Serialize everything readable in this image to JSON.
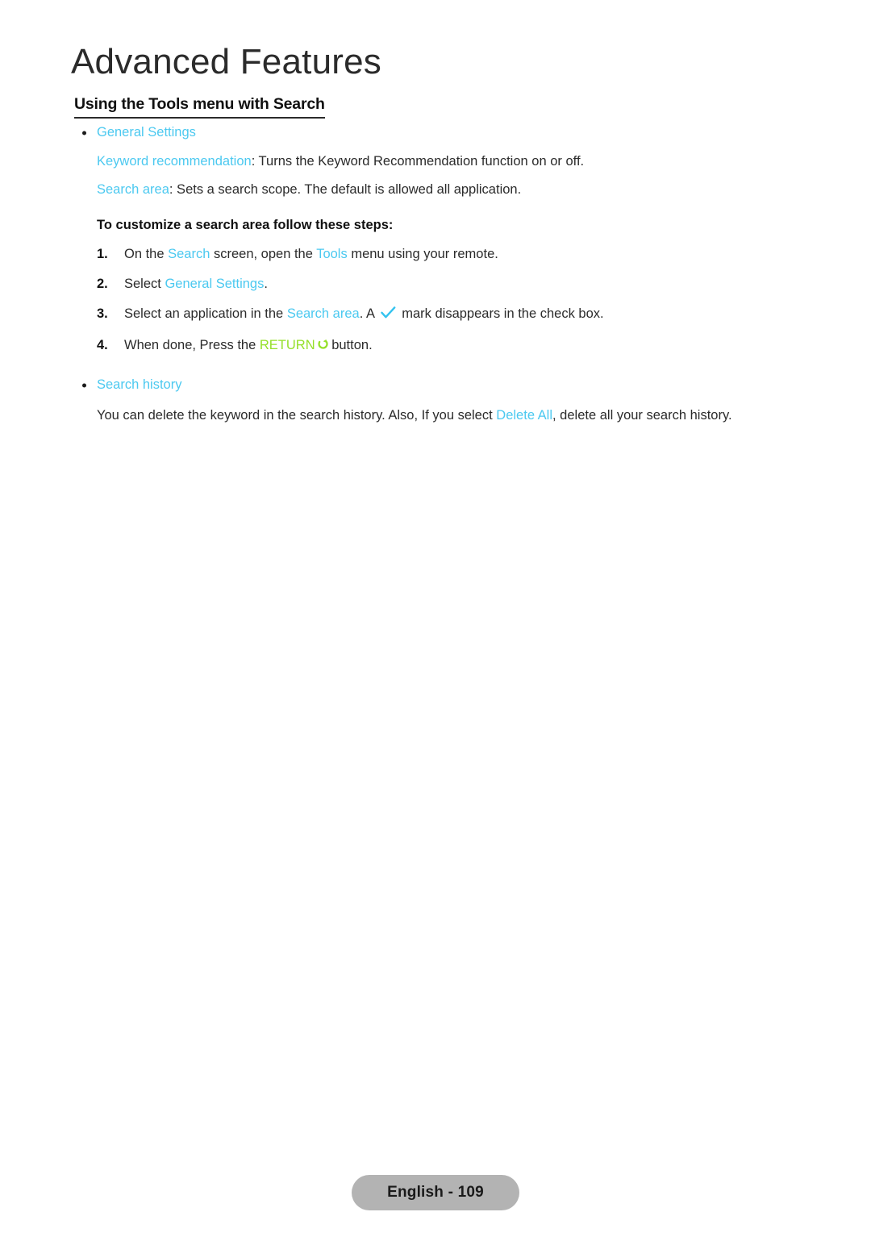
{
  "document": {
    "chapter_title": "Advanced Features",
    "section_heading": "Using the Tools menu with Search"
  },
  "general_settings": {
    "bullet_label": "General Settings",
    "keyword_recommendation": {
      "term": "Keyword recommendation",
      "description": ": Turns the Keyword Recommendation function on or off."
    },
    "search_area": {
      "term": "Search area",
      "description": ": Sets a search scope. The default is allowed all application."
    }
  },
  "procedure": {
    "intro": "To customize a search area follow these steps:",
    "steps": [
      {
        "number": "1.",
        "text_before": "On the ",
        "highlight_1": "Search",
        "text_middle": " screen, open the ",
        "highlight_2": "Tools",
        "text_after": " menu using your remote."
      },
      {
        "number": "2.",
        "text_before": "Select ",
        "highlight_1": "General Settings",
        "text_after": "."
      },
      {
        "number": "3.",
        "text_before": "Select an application in the ",
        "highlight_1": "Search area",
        "text_middle": ". A ",
        "icon": "check-mark-icon",
        "text_after": " mark disappears in the check box."
      },
      {
        "number": "4.",
        "text_before": "When done, Press the ",
        "highlight_green": "RETURN",
        "icon": "return-arrow-icon",
        "text_after": " button."
      }
    ]
  },
  "search_history": {
    "bullet_label": "Search history",
    "description_before": "You can delete the keyword in the search history. Also, If you select ",
    "highlight": "Delete All",
    "description_after": ", delete all your search history."
  },
  "footer": {
    "page_label": "English - 109"
  },
  "colors": {
    "highlight_cyan": "#4cc9f0",
    "highlight_green": "#95e02a",
    "text": "#2b2b2b",
    "badge_background": "#b3b3b3"
  }
}
